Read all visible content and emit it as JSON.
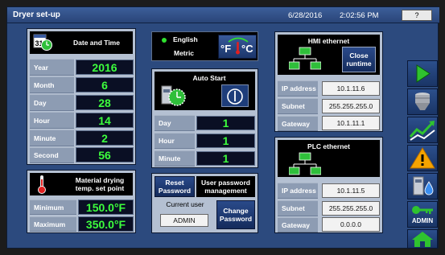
{
  "header": {
    "title": "Dryer set-up",
    "date": "6/28/2016",
    "time": "2:02:56 PM",
    "help_label": "?"
  },
  "date_time": {
    "heading": "Date and Time",
    "icon_day": "31",
    "rows": [
      {
        "label": "Year",
        "value": "2016"
      },
      {
        "label": "Month",
        "value": "6"
      },
      {
        "label": "Day",
        "value": "28"
      },
      {
        "label": "Hour",
        "value": "14"
      },
      {
        "label": "Minute",
        "value": "2"
      },
      {
        "label": "Second",
        "value": "56"
      }
    ]
  },
  "units": {
    "english_label": "English",
    "metric_label": "Metric",
    "temp_toggle_f": "°F",
    "temp_toggle_c": "°C"
  },
  "auto_start": {
    "heading": "Auto Start",
    "rows": [
      {
        "label": "Day",
        "value": "1"
      },
      {
        "label": "Hour",
        "value": "1"
      },
      {
        "label": "Minute",
        "value": "1"
      }
    ]
  },
  "material": {
    "heading": "Material drying temp. set point",
    "rows": [
      {
        "label": "Minimum",
        "value": "150.0°F"
      },
      {
        "label": "Maximum",
        "value": "350.0°F"
      }
    ]
  },
  "password": {
    "reset_label": "Reset Password",
    "management_label": "User password management",
    "current_user_label": "Current user",
    "current_user_value": "ADMIN",
    "change_label": "Change Password"
  },
  "hmi": {
    "heading": "HMI ethernet",
    "close_label": "Close runtime",
    "rows": [
      {
        "label": "IP address",
        "value": "10.1.11.6"
      },
      {
        "label": "Subnet",
        "value": "255.255.255.0"
      },
      {
        "label": "Gateway",
        "value": "10.1.11.1"
      }
    ]
  },
  "plc": {
    "heading": "PLC ethernet",
    "rows": [
      {
        "label": "IP address",
        "value": "10.1.11.5"
      },
      {
        "label": "Subnet",
        "value": "255.255.255.0"
      },
      {
        "label": "Gateway",
        "value": "0.0.0.0"
      }
    ]
  },
  "sidebar": {
    "admin_label": "ADMIN"
  },
  "colors": {
    "background": "#2c4a7e",
    "value_text": "#3dff3d",
    "panel": "#b4c0d2",
    "warning": "#f5a300",
    "nav_green": "#2fc32f"
  }
}
